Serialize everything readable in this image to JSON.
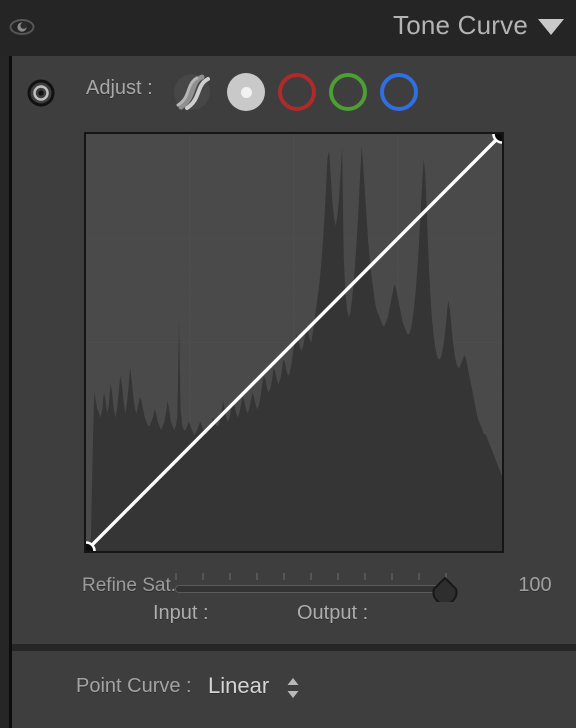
{
  "header": {
    "title": "Tone Curve",
    "eye_icon": "eye-icon",
    "disclosure_icon": "triangle-down-icon"
  },
  "adjust": {
    "label": "Adjust :",
    "target_tool_icon": "target-adjustment-icon",
    "channels": [
      {
        "id": "scurve",
        "icon": "s-curve-icon",
        "color": "#9a9a9a",
        "selected": false
      },
      {
        "id": "white",
        "icon": "white-channel-icon",
        "color": "#c9c9c9",
        "selected": true
      },
      {
        "id": "red",
        "icon": "red-channel-icon",
        "color": "#b02a2a",
        "selected": false
      },
      {
        "id": "green",
        "icon": "green-channel-icon",
        "color": "#4e9e36",
        "selected": false
      },
      {
        "id": "blue",
        "icon": "blue-channel-icon",
        "color": "#2f6fe0",
        "selected": false
      }
    ]
  },
  "curve": {
    "type": "tone-curve",
    "curve_points": [
      {
        "input": 0,
        "output": 0
      },
      {
        "input": 255,
        "output": 255
      }
    ],
    "curve_color": "#ffffff",
    "grid_color": "#565656",
    "background": "#4a4a4a",
    "histogram_color": "#353535",
    "histogram_values": [
      0,
      0,
      1,
      3,
      22,
      38,
      36,
      34,
      33,
      32,
      34,
      38,
      36,
      33,
      35,
      40,
      38,
      34,
      32,
      34,
      38,
      42,
      40,
      36,
      33,
      35,
      39,
      44,
      41,
      37,
      34,
      33,
      35,
      37,
      36,
      34,
      32,
      31,
      30,
      30,
      31,
      32,
      34,
      33,
      31,
      30,
      29,
      30,
      31,
      33,
      36,
      34,
      31,
      30,
      29,
      30,
      32,
      55,
      34,
      30,
      29,
      29,
      30,
      31,
      30,
      29,
      28,
      28,
      29,
      30,
      31,
      30,
      29,
      28,
      28,
      29,
      30,
      31,
      32,
      31,
      30,
      30,
      31,
      33,
      36,
      34,
      32,
      31,
      32,
      34,
      36,
      35,
      33,
      32,
      33,
      35,
      37,
      36,
      34,
      33,
      34,
      36,
      38,
      37,
      35,
      34,
      35,
      37,
      40,
      42,
      41,
      39,
      38,
      39,
      41,
      44,
      43,
      41,
      40,
      41,
      43,
      46,
      45,
      43,
      42,
      43,
      45,
      48,
      50,
      52,
      51,
      49,
      48,
      49,
      51,
      54,
      53,
      51,
      50,
      52,
      55,
      58,
      61,
      64,
      68,
      73,
      79,
      86,
      94,
      96,
      90,
      84,
      80,
      78,
      80,
      84,
      90,
      97,
      70,
      62,
      58,
      56,
      57,
      60,
      64,
      69,
      75,
      82,
      90,
      97,
      92,
      86,
      80,
      74,
      70,
      66,
      63,
      60,
      58,
      57,
      56,
      55,
      54,
      54,
      55,
      56,
      58,
      60,
      62,
      64,
      63,
      61,
      59,
      57,
      55,
      54,
      53,
      52,
      52,
      53,
      55,
      58,
      62,
      67,
      73,
      80,
      88,
      94,
      90,
      80,
      70,
      62,
      56,
      52,
      49,
      47,
      46,
      46,
      47,
      49,
      52,
      56,
      60,
      58,
      54,
      50,
      47,
      45,
      44,
      44,
      45,
      46,
      47,
      46,
      44,
      42,
      40,
      38,
      36,
      34,
      32,
      31,
      30,
      29,
      28,
      28,
      27,
      26,
      25,
      24,
      23,
      22,
      21,
      20,
      19,
      18
    ]
  },
  "refine_sat": {
    "label": "Refine Sat.",
    "value": "100",
    "value_number": 100,
    "min": 0,
    "max": 100,
    "tick_count": 11
  },
  "io": {
    "input_label": "Input :",
    "output_label": "Output :"
  },
  "point_curve": {
    "label": "Point Curve :",
    "value": "Linear",
    "stepper_icon": "stepper-up-down-icon"
  }
}
